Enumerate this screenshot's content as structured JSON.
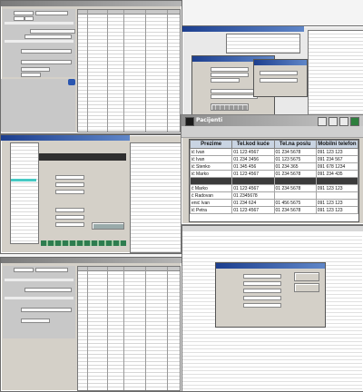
{
  "pacijenti": {
    "title": "Pacijenti",
    "columns": [
      "Prezime",
      "Tel.kod kuće",
      "Tel.na poslu",
      "Mobilni telefon"
    ],
    "rows": [
      [
        "ić Ivan",
        "01 123 4567",
        "01 234 5678",
        "091 123 123"
      ],
      [
        "ić Ivan",
        "01 234 3456",
        "01 123 5675",
        "091 234 567"
      ],
      [
        "ić Stenko",
        "01 345 456",
        "01 234 365",
        "091 678 1234"
      ],
      [
        "ić Marko",
        "01 123 4567",
        "01 234 5678",
        "091 234 435"
      ],
      [
        "",
        "",
        "",
        ""
      ],
      [
        "ć Marko",
        "01 123 4567",
        "01 234 5678",
        "091 123 123"
      ],
      [
        "ć Radovan",
        "01 2345678",
        "",
        ""
      ],
      [
        "enić Ivan",
        "01 234 624",
        "01 456 5675",
        "091 123 123"
      ],
      [
        "ić Petra",
        "01 123 4567",
        "01 234 5678",
        "091 123 123"
      ]
    ],
    "selected_row": 4
  }
}
